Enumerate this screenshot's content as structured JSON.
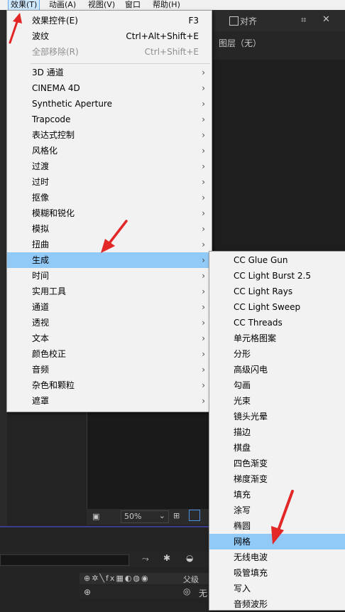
{
  "menubar": {
    "items": [
      {
        "label": "效果(T)",
        "active": true
      },
      {
        "label": "动画(A)"
      },
      {
        "label": "视图(V)"
      },
      {
        "label": "窗口"
      },
      {
        "label": "帮助(H)"
      }
    ]
  },
  "background": {
    "align_label": "对齐",
    "layer_label": "图层（无）",
    "zoom": "50%",
    "parent_label": "父级",
    "none_label": "无"
  },
  "effects_menu": {
    "top_items": [
      {
        "label": "效果控件(E)",
        "shortcut": "F3"
      },
      {
        "label": "波纹",
        "shortcut": "Ctrl+Alt+Shift+E"
      },
      {
        "label": "全部移除(R)",
        "shortcut": "Ctrl+Shift+E",
        "disabled": true
      }
    ],
    "categories": [
      "3D 通道",
      "CINEMA 4D",
      "Synthetic Aperture",
      "Trapcode",
      "表达式控制",
      "风格化",
      "过渡",
      "过时",
      "抠像",
      "模糊和锐化",
      "模拟",
      "扭曲",
      "生成",
      "时间",
      "实用工具",
      "通道",
      "透视",
      "文本",
      "颜色校正",
      "音频",
      "杂色和颗粒",
      "遮罩"
    ],
    "chevron": "›",
    "selected": "生成"
  },
  "generate_submenu": {
    "items": [
      "CC Glue Gun",
      "CC Light Burst 2.5",
      "CC Light Rays",
      "CC Light Sweep",
      "CC Threads",
      "单元格图案",
      "分形",
      "高级闪电",
      "勾画",
      "光束",
      "镜头光晕",
      "描边",
      "棋盘",
      "四色渐变",
      "梯度渐变",
      "填充",
      "涂写",
      "椭圆",
      "网格",
      "无线电波",
      "吸管填充",
      "写入",
      "音频波形"
    ],
    "selected": "网格"
  },
  "colors": {
    "highlight": "#91c9f7",
    "arrow": "#e32626",
    "menu_bg": "#f2f2f2"
  }
}
